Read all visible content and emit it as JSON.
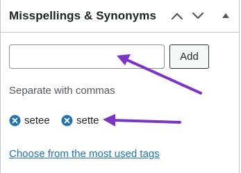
{
  "header": {
    "title": "Misspellings & Synonyms",
    "icons": [
      "chevron-up-icon",
      "chevron-down-icon",
      "triangle-up-icon"
    ]
  },
  "tag_input": {
    "value": "",
    "placeholder": ""
  },
  "add_label": "Add",
  "hint": "Separate with commas",
  "tags": [
    {
      "label": "setee",
      "icon": "remove-icon"
    },
    {
      "label": "sette",
      "icon": "remove-icon"
    }
  ],
  "link_label": "Choose from the most used tags",
  "colors": {
    "text": "#1d2327",
    "hint": "#50575e",
    "link": "#2271b1",
    "border": "#c3c4c7",
    "annotation_arrow": "#7b35c4"
  }
}
